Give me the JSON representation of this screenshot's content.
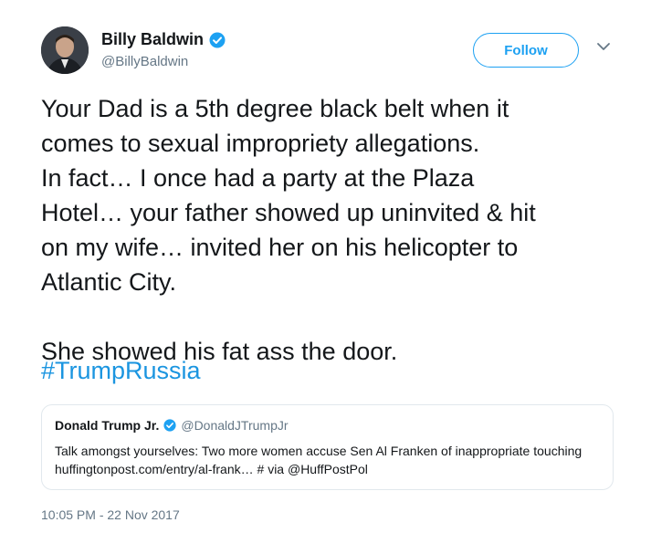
{
  "author": {
    "name": "Billy Baldwin",
    "handle": "@BillyBaldwin",
    "verified": true
  },
  "follow_label": "Follow",
  "tweet": {
    "text": "Your Dad is a 5th degree black belt when it\ncomes to sexual impropriety allegations.\nIn fact… I once had a party at the Plaza\nHotel… your father showed up uninvited & hit\non my wife… invited her on his helicopter to\nAtlantic City.\n\nShe showed his fat ass the door.",
    "hashtag": "#TrumpRussia"
  },
  "quoted": {
    "name": "Donald Trump Jr.",
    "handle": "@DonaldJTrumpJr",
    "text": "Talk amongst yourselves: Two more women accuse Sen Al Franken of inappropriate touching huffingtonpost.com/entry/al-frank… # via @HuffPostPol"
  },
  "timestamp": "10:05 PM - 22 Nov 2017",
  "colors": {
    "accent": "#1da1f2",
    "link": "#1b95e0",
    "secondary_text": "#657786"
  },
  "icons": {
    "verified": "verified-badge-icon",
    "caret": "chevron-down-icon"
  }
}
